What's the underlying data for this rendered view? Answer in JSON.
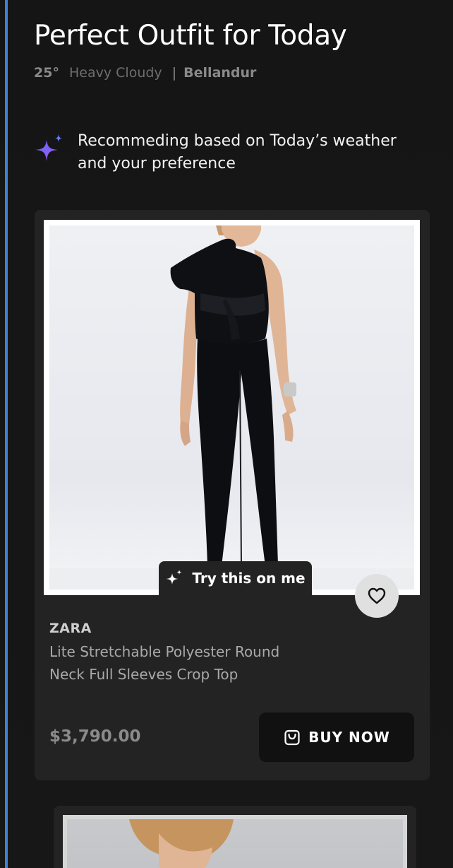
{
  "header": {
    "title": "Perfect Outfit for Today",
    "temperature": "25°",
    "condition": "Heavy Cloudy",
    "separator": "|",
    "location": "Bellandur"
  },
  "recommendation": {
    "icon": "sparkle-icon",
    "text": "Recommeding based on Today’s weather and your preference"
  },
  "product": {
    "image_alt": "Black one-shoulder jumpsuit",
    "try_on_label": "Try this on me",
    "try_on_icon": "sparkle-icon",
    "favorite_icon": "heart-icon",
    "brand": "ZARA",
    "description": "Lite Stretchable Polyester Round Neck Full Sleeves Crop Top",
    "price": "$3,790.00",
    "buy_label": "BUY NOW",
    "buy_icon": "shopping-bag-icon"
  },
  "colors": {
    "accent_bar": "#3b82d6",
    "sparkle_gradient_start": "#4f6df5",
    "sparkle_gradient_end": "#a855f7",
    "card_bg": "#232323",
    "buy_button_bg": "#111111"
  }
}
